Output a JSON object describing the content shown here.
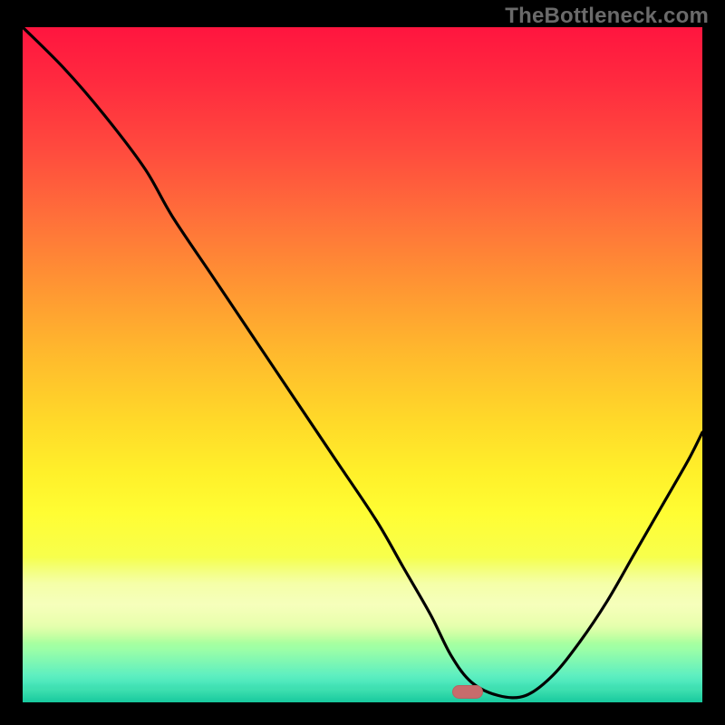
{
  "watermark": "TheBottleneck.com",
  "marker": {
    "color": "#c76c6c",
    "x_frac": 0.655,
    "y_frac": 0.985
  },
  "chart_data": {
    "type": "line",
    "title": "",
    "xlabel": "",
    "ylabel": "",
    "xlim": [
      0,
      100
    ],
    "ylim": [
      0,
      100
    ],
    "series": [
      {
        "name": "bottleneck-curve",
        "x": [
          0,
          6,
          12,
          18,
          22,
          28,
          34,
          40,
          46,
          52,
          56,
          60,
          63,
          66,
          70,
          74,
          78,
          82,
          86,
          90,
          94,
          98,
          100
        ],
        "y": [
          100,
          94,
          87,
          79,
          72,
          63,
          54,
          45,
          36,
          27,
          20,
          13,
          7,
          3,
          1,
          1,
          4,
          9,
          15,
          22,
          29,
          36,
          40
        ]
      }
    ],
    "annotations": [
      {
        "kind": "marker",
        "x": 65.5,
        "y": 1.5,
        "shape": "rounded-rect",
        "color": "#c76c6c"
      }
    ],
    "background": {
      "style": "vertical-gradient",
      "stops": [
        {
          "pos": 0.0,
          "color": "#ff153f"
        },
        {
          "pos": 0.5,
          "color": "#ffd829"
        },
        {
          "pos": 0.78,
          "color": "#f8ff4a"
        },
        {
          "pos": 1.0,
          "color": "#17c99e"
        }
      ]
    }
  }
}
